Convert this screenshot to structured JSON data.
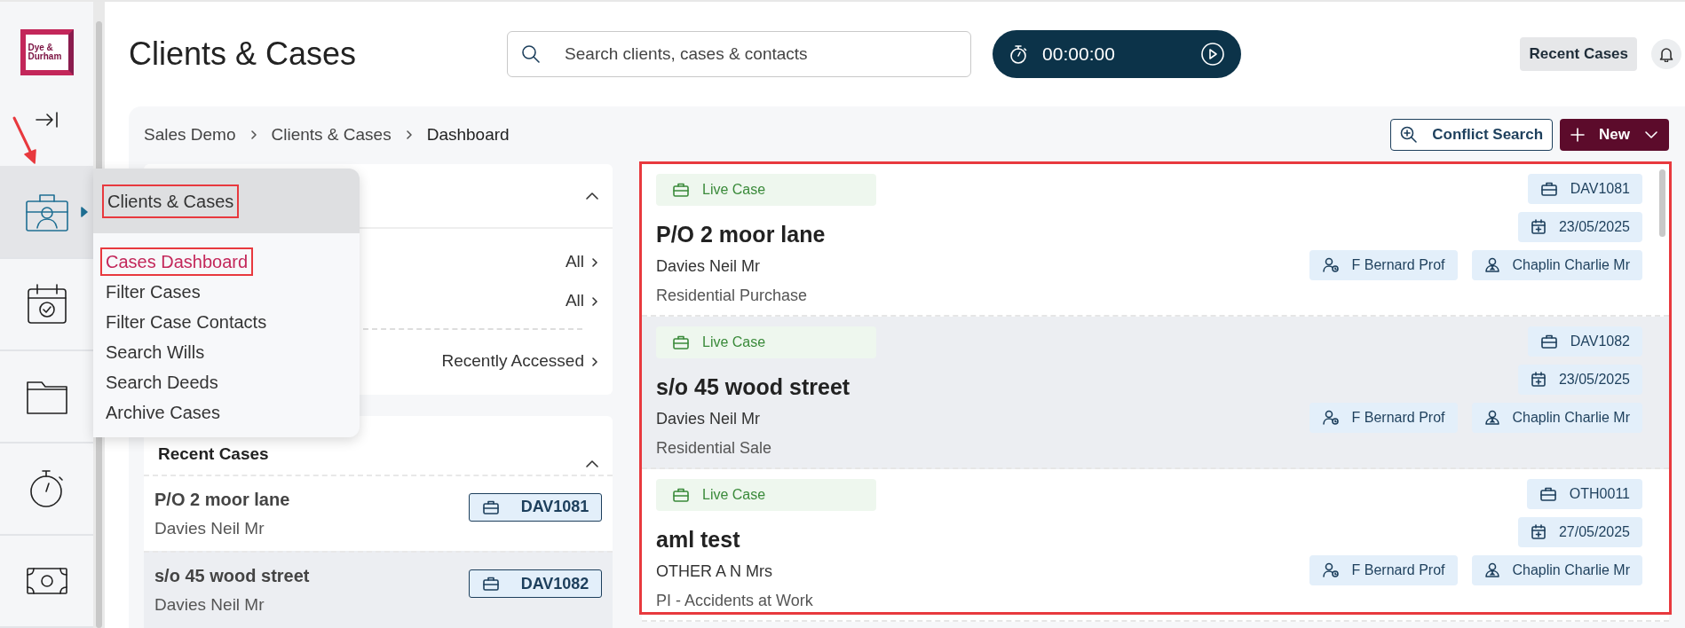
{
  "sidebar": {
    "logo": {
      "line1": "Dye &",
      "line2": "Durham"
    },
    "nav": [
      {
        "kind": "clients",
        "selected": true,
        "has_submenu": true
      },
      {
        "kind": "calendar",
        "selected": false,
        "has_submenu": false
      },
      {
        "kind": "folder",
        "selected": false,
        "has_submenu": false
      },
      {
        "kind": "timer",
        "selected": false,
        "has_submenu": false
      },
      {
        "kind": "money",
        "selected": false,
        "has_submenu": false
      }
    ]
  },
  "pointer_arrow": true,
  "flyout": {
    "title": "Clients & Cases",
    "title_highlighted": true,
    "items": [
      {
        "label": "Cases Dashboard",
        "selected": true,
        "highlighted": true
      },
      {
        "label": "Filter Cases",
        "selected": false,
        "highlighted": false
      },
      {
        "label": "Filter Case Contacts",
        "selected": false,
        "highlighted": false
      },
      {
        "label": "Search Wills",
        "selected": false,
        "highlighted": false
      },
      {
        "label": "Search Deeds",
        "selected": false,
        "highlighted": false
      },
      {
        "label": "Archive Cases",
        "selected": false,
        "highlighted": false
      }
    ]
  },
  "header": {
    "title": "Clients & Cases",
    "search": {
      "placeholder": "Search clients, cases & contacts"
    },
    "timer": {
      "time": "00:00:00"
    },
    "recent_cases_button": "Recent Cases"
  },
  "breadcrumb": [
    {
      "label": "Sales Demo",
      "current": false
    },
    {
      "label": "Clients & Cases",
      "current": false
    },
    {
      "label": "Dashboard",
      "current": true
    }
  ],
  "actions": {
    "conflict_search": "Conflict Search",
    "new": "New"
  },
  "filters": {
    "rows": [
      {
        "value": "All"
      },
      {
        "value": "All"
      },
      {
        "value": "Recently Accessed"
      }
    ]
  },
  "recent_cases": {
    "title": "Recent Cases",
    "items": [
      {
        "title": "P/O 2 moor lane",
        "client": "Davies Neil Mr",
        "reference": "DAV1081",
        "shaded": false
      },
      {
        "title": "s/o 45 wood street",
        "client": "Davies Neil Mr",
        "reference": "DAV1082",
        "shaded": true
      }
    ]
  },
  "case_list": {
    "highlighted": true,
    "cases": [
      {
        "status": "Live Case",
        "title": "P/O 2 moor lane",
        "client": "Davies Neil Mr",
        "type": "Residential Purchase",
        "reference": "DAV1081",
        "date": "23/05/2025",
        "fee_earner": "F Bernard Prof",
        "supervisor": "Chaplin Charlie Mr",
        "shaded": false
      },
      {
        "status": "Live Case",
        "title": "s/o 45 wood street",
        "client": "Davies Neil Mr",
        "type": "Residential Sale",
        "reference": "DAV1082",
        "date": "23/05/2025",
        "fee_earner": "F Bernard Prof",
        "supervisor": "Chaplin Charlie Mr",
        "shaded": true
      },
      {
        "status": "Live Case",
        "title": "aml test",
        "client": "OTHER A N Mrs",
        "type": "PI - Accidents at Work",
        "reference": "OTH0011",
        "date": "27/05/2025",
        "fee_earner": "F Bernard Prof",
        "supervisor": "Chaplin Charlie Mr",
        "shaded": false
      }
    ]
  }
}
